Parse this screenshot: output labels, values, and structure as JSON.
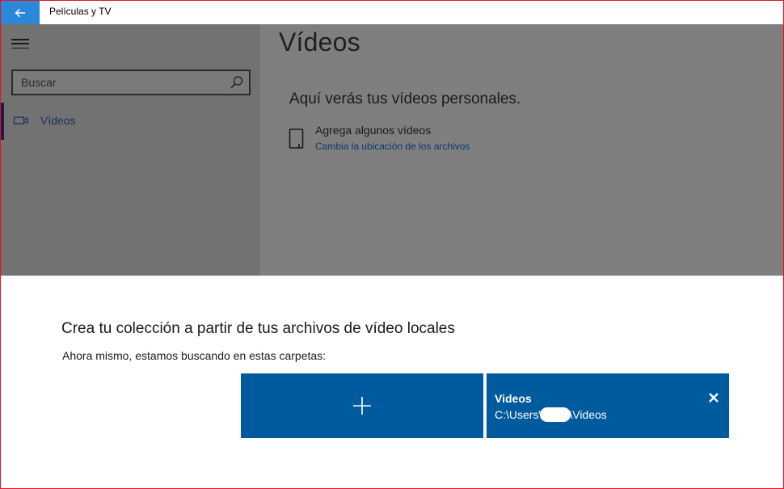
{
  "window": {
    "title": "Películas y TV",
    "border_color": "#e81123"
  },
  "titlebar": {
    "back_icon": "arrow-left-icon",
    "back_button_color": "#2b88d8"
  },
  "sidebar": {
    "menu_icon": "hamburger-icon",
    "search": {
      "placeholder": "Buscar",
      "value": "",
      "icon": "search-icon"
    },
    "items": [
      {
        "label": "Vídeos",
        "icon": "video-camera-icon",
        "selected": true
      }
    ]
  },
  "main": {
    "page_title": "Vídeos",
    "empty_heading": "Aquí verás tus vídeos personales.",
    "add_text": "Agrega algunos vídeos",
    "change_link": "Cambia la ubicación de los archivos",
    "add_icon": "tablet-device-icon"
  },
  "dialog": {
    "title": "Crea tu colección a partir de tus archivos de vídeo locales",
    "subtitle": "Ahora mismo, estamos buscando en estas carpetas:",
    "add_tile_icon": "plus-icon",
    "tile_color": "#005a9e",
    "folders": [
      {
        "name": "Videos",
        "path_prefix": "C:\\Users\\",
        "path_suffix": "\\Videos",
        "remove_icon": "close-icon"
      }
    ]
  }
}
